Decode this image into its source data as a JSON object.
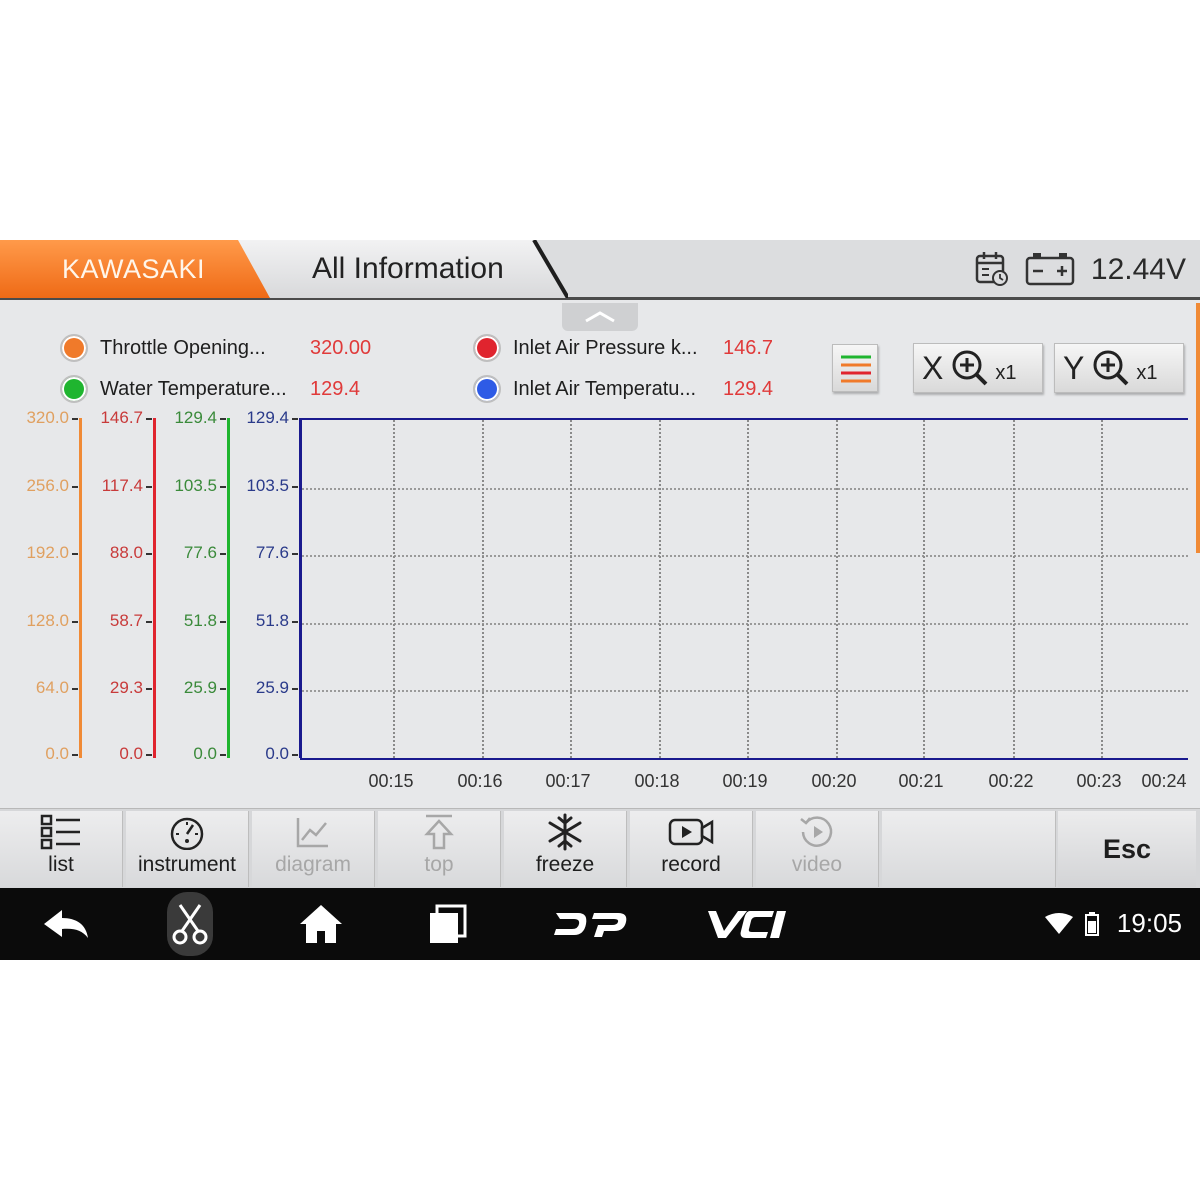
{
  "header": {
    "brand_tab": "KAWASAKI",
    "title_tab": "All Information",
    "voltage": "12.44V",
    "icons": [
      "calendar-icon",
      "battery-icon"
    ]
  },
  "legend": [
    {
      "label": "Throttle Opening...",
      "value": "320.00",
      "color": "#f07a2a"
    },
    {
      "label": "Inlet Air Pressure  k...",
      "value": "146.7",
      "color": "#e0242e"
    },
    {
      "label": "Water Temperature...",
      "value": "129.4",
      "color": "#1fb52f"
    },
    {
      "label": "Inlet Air Temperatu...",
      "value": "129.4",
      "color": "#2e5be6"
    }
  ],
  "zoom": {
    "x": {
      "axis": "X",
      "mult": "x1"
    },
    "y": {
      "axis": "Y",
      "mult": "x1"
    }
  },
  "axes": [
    {
      "color": "#e0a060",
      "line": "#f08a36",
      "ticks": [
        "320.0",
        "256.0",
        "192.0",
        "128.0",
        "64.0",
        "0.0"
      ]
    },
    {
      "color": "#c83a3a",
      "line": "#e0242e",
      "ticks": [
        "146.7",
        "117.4",
        "88.0",
        "58.7",
        "29.3",
        "0.0"
      ]
    },
    {
      "color": "#3a8a3a",
      "line": "#1fb52f",
      "ticks": [
        "129.4",
        "103.5",
        "77.6",
        "51.8",
        "25.9",
        "0.0"
      ]
    },
    {
      "color": "#2a3a8a",
      "line": "#1a1a8e",
      "ticks": [
        "129.4",
        "103.5",
        "77.6",
        "51.8",
        "25.9",
        "0.0"
      ]
    }
  ],
  "x_labels": [
    "00:15",
    "00:16",
    "00:17",
    "00:18",
    "00:19",
    "00:20",
    "00:21",
    "00:22",
    "00:23",
    "00:24"
  ],
  "toolbar": {
    "list": "list",
    "instrument": "instrument",
    "diagram": "diagram",
    "top": "top",
    "freeze": "freeze",
    "record": "record",
    "video": "video",
    "esc": "Esc"
  },
  "navbar": {
    "dp": "DP",
    "vci": "VCI",
    "time": "19:05"
  }
}
